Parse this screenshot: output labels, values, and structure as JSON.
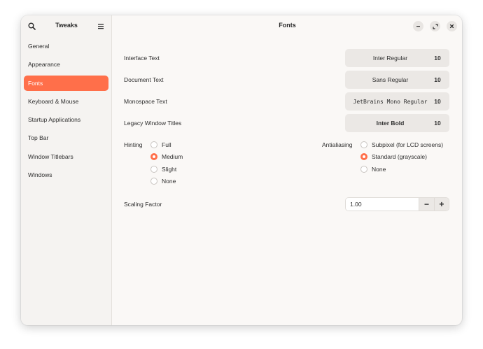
{
  "sidebar": {
    "title": "Tweaks",
    "items": [
      {
        "label": "General"
      },
      {
        "label": "Appearance"
      },
      {
        "label": "Fonts"
      },
      {
        "label": "Keyboard & Mouse"
      },
      {
        "label": "Startup Applications"
      },
      {
        "label": "Top Bar"
      },
      {
        "label": "Window Titlebars"
      },
      {
        "label": "Windows"
      }
    ],
    "active_index": 2
  },
  "main": {
    "title": "Fonts",
    "font_rows": [
      {
        "label": "Interface Text",
        "font": "Inter Regular",
        "size": "10"
      },
      {
        "label": "Document Text",
        "font": "Sans Regular",
        "size": "10"
      },
      {
        "label": "Monospace Text",
        "font": "JetBrains Mono Regular",
        "size": "10"
      },
      {
        "label": "Legacy Window Titles",
        "font": "Inter Bold",
        "size": "10"
      }
    ],
    "hinting": {
      "label": "Hinting",
      "options": [
        "Full",
        "Medium",
        "Slight",
        "None"
      ],
      "selected": "Medium"
    },
    "antialiasing": {
      "label": "Antialiasing",
      "options": [
        "Subpixel (for LCD screens)",
        "Standard (grayscale)",
        "None"
      ],
      "selected": "Standard (grayscale)"
    },
    "scaling": {
      "label": "Scaling Factor",
      "value": "1.00",
      "minus": "−",
      "plus": "+"
    }
  },
  "colors": {
    "accent": "#ff6f4a",
    "window_bg": "#faf8f6",
    "sidebar_bg": "#f5f3f1",
    "button_bg": "#ebe8e5"
  },
  "icons": [
    "search-icon",
    "hamburger-menu-icon",
    "minimize-icon",
    "maximize-icon",
    "close-icon"
  ]
}
